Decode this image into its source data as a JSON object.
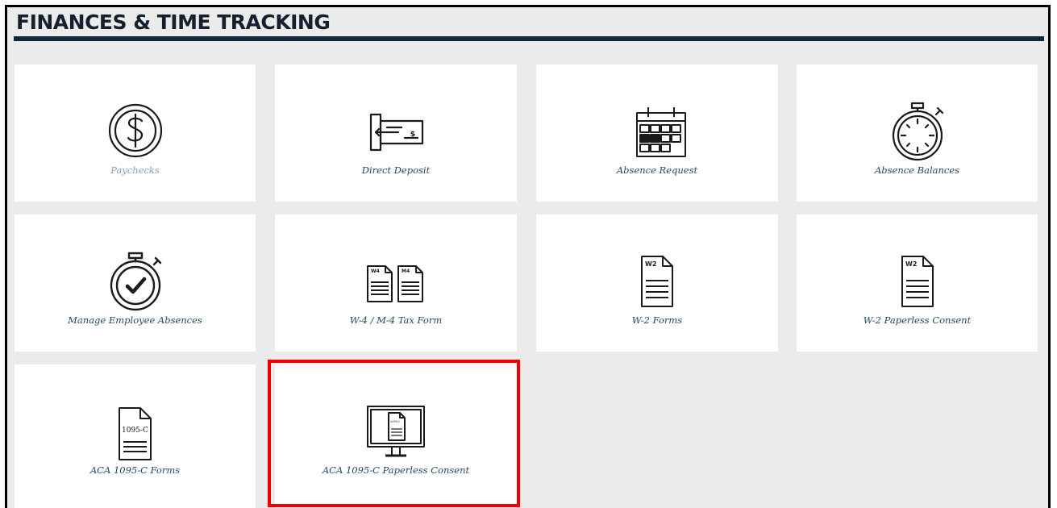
{
  "section": {
    "title": "FINANCES & TIME TRACKING"
  },
  "tiles": [
    {
      "label": "Paychecks",
      "icon": "dollar-coin-icon"
    },
    {
      "label": "Direct Deposit",
      "icon": "check-deposit-icon"
    },
    {
      "label": "Absence Request",
      "icon": "calendar-icon"
    },
    {
      "label": "Absence Balances",
      "icon": "stopwatch-icon"
    },
    {
      "label": "Manage Employee Absences",
      "icon": "stopwatch-check-icon"
    },
    {
      "label": "W-4 / M-4 Tax Form",
      "icon": "tax-forms-icon",
      "doc_tags": [
        "W4",
        "M4"
      ]
    },
    {
      "label": "W-2 Forms",
      "icon": "w2-document-icon",
      "doc_tag": "W2"
    },
    {
      "label": "W-2 Paperless Consent",
      "icon": "w2-document-icon",
      "doc_tag": "W2"
    },
    {
      "label": "ACA 1095-C Forms",
      "icon": "1095c-document-icon",
      "doc_tag": "1095-C"
    },
    {
      "label": "ACA 1095-C Paperless Consent",
      "icon": "monitor-document-icon",
      "doc_tag": "1095-C"
    }
  ],
  "colors": {
    "background": "#ebebeb",
    "title": "#14202e",
    "label": "#1f4a62",
    "label_muted": "#7fa4b9",
    "highlight": "#ee0000"
  }
}
